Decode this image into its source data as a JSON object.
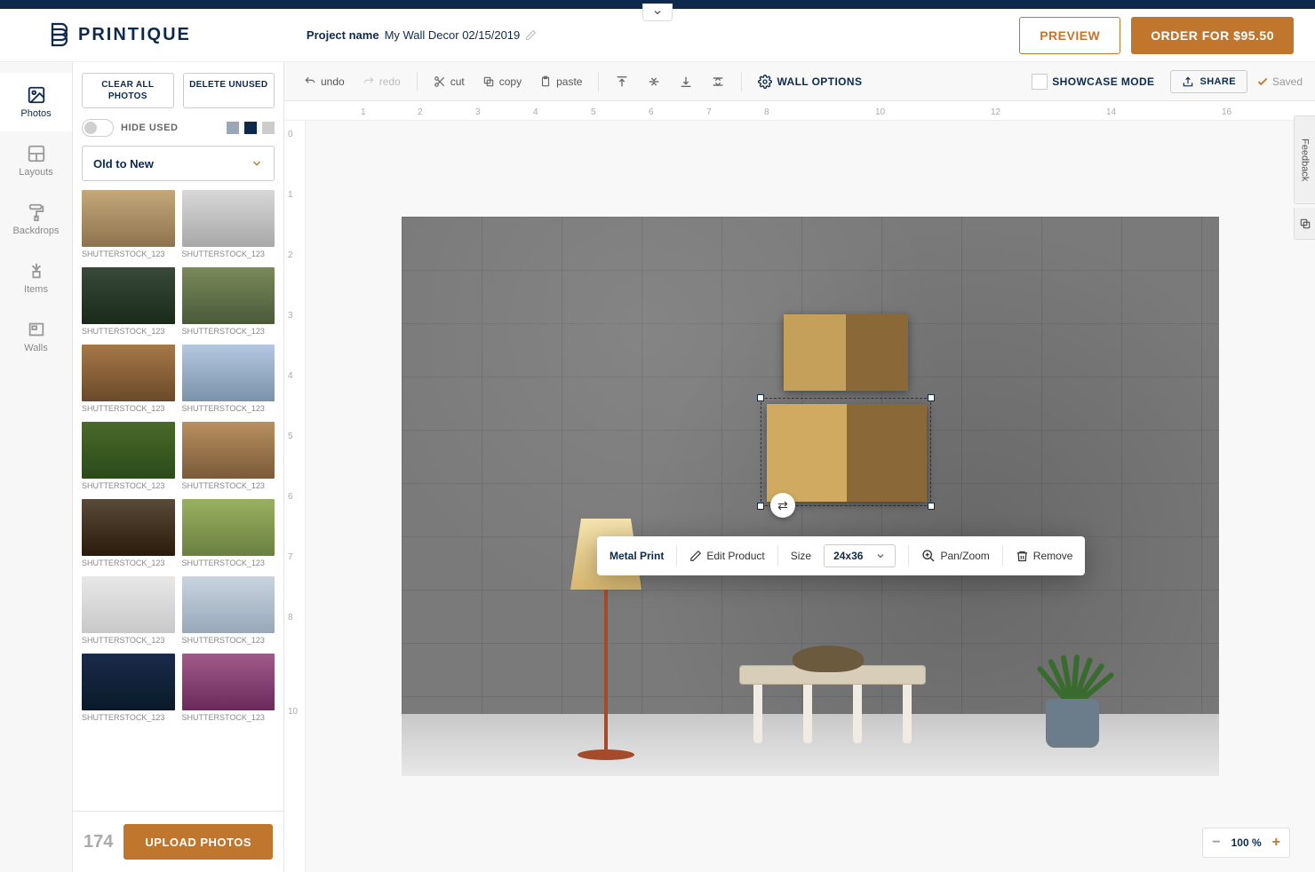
{
  "brand": "PRINTIQUE",
  "project": {
    "label": "Project name",
    "value": "My Wall Decor 02/15/2019"
  },
  "header": {
    "preview": "PREVIEW",
    "order": "ORDER FOR $95.50"
  },
  "dropdown_tab": "chevron-down",
  "rail": [
    {
      "icon": "image",
      "label": "Photos",
      "active": true
    },
    {
      "icon": "grid",
      "label": "Layouts",
      "active": false
    },
    {
      "icon": "roller",
      "label": "Backdrops",
      "active": false
    },
    {
      "icon": "plant",
      "label": "Items",
      "active": false
    },
    {
      "icon": "wall",
      "label": "Walls",
      "active": false
    }
  ],
  "side_panel": {
    "clear_all": "CLEAR ALL PHOTOS",
    "delete_unused": "DELETE UNUSED",
    "hide_used": "HIDE USED",
    "sort": "Old to New",
    "thumbs": [
      "SHUTTERSTOCK_123",
      "SHUTTERSTOCK_123",
      "SHUTTERSTOCK_123",
      "SHUTTERSTOCK_123",
      "SHUTTERSTOCK_123",
      "SHUTTERSTOCK_123",
      "SHUTTERSTOCK_123",
      "SHUTTERSTOCK_123",
      "SHUTTERSTOCK_123",
      "SHUTTERSTOCK_123",
      "SHUTTERSTOCK_123",
      "SHUTTERSTOCK_123",
      "SHUTTERSTOCK_123",
      "SHUTTERSTOCK_123"
    ],
    "count": "174",
    "upload": "UPLOAD PHOTOS"
  },
  "toolbar": {
    "undo": "undo",
    "redo": "redo",
    "cut": "cut",
    "copy": "copy",
    "paste": "paste",
    "wall_options": "WALL OPTIONS",
    "showcase": "SHOWCASE MODE",
    "share": "SHARE",
    "saved": "Saved"
  },
  "ruler_h": [
    "1",
    "2",
    "3",
    "4",
    "5",
    "6",
    "7",
    "8",
    "10",
    "12",
    "14",
    "16"
  ],
  "ruler_v": [
    "0",
    "1",
    "2",
    "3",
    "4",
    "5",
    "6",
    "7",
    "8",
    "10"
  ],
  "floatbar": {
    "product": "Metal Print",
    "edit": "Edit Product",
    "size_label": "Size",
    "size_value": "24x36",
    "panzoom": "Pan/Zoom",
    "remove": "Remove"
  },
  "zoom": {
    "value": "100 %"
  },
  "feedback": "Feedback"
}
